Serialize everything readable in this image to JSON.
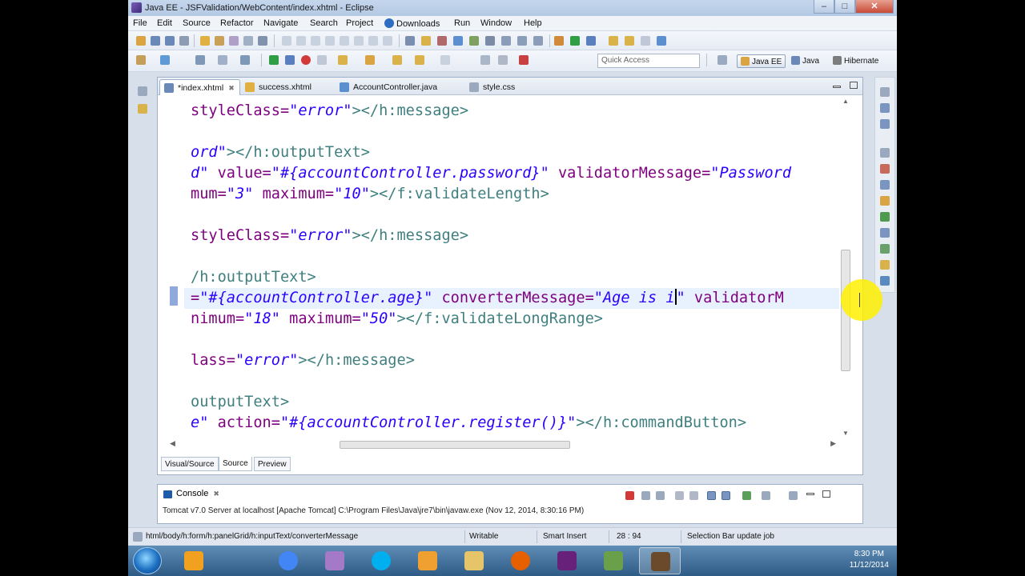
{
  "window": {
    "title": "Java EE - JSFValidation/WebContent/index.xhtml - Eclipse"
  },
  "menu": [
    "File",
    "Edit",
    "Source",
    "Refactor",
    "Navigate",
    "Search",
    "Project",
    "Downloads",
    "Run",
    "Window",
    "Help"
  ],
  "toolbar": {
    "quick_access_placeholder": "Quick Access"
  },
  "perspectives": [
    {
      "label": "Java EE",
      "active": true
    },
    {
      "label": "Java",
      "active": false
    },
    {
      "label": "Hibernate",
      "active": false
    }
  ],
  "editor": {
    "tabs": [
      {
        "label": "*index.xhtml",
        "active": true
      },
      {
        "label": "success.xhtml",
        "active": false
      },
      {
        "label": "AccountController.java",
        "active": false
      },
      {
        "label": "style.css",
        "active": false
      }
    ],
    "code": {
      "l1": {
        "a": "styleClass=",
        "b": "\"error\"",
        "c": "></h:message>"
      },
      "l2": {
        "a": "ord\"",
        "b": "></h:outputText>"
      },
      "l3": {
        "a": "d\"",
        "b": " value=",
        "c": "\"#{accountController.password}\"",
        "d": " validatorMessage=",
        "e": "\"Password"
      },
      "l4": {
        "a": "mum=",
        "b": "\"3\"",
        "c": " maximum=",
        "d": "\"10\"",
        "e": "></f:validateLength>"
      },
      "l5": {
        "a": "styleClass=",
        "b": "\"error\"",
        "c": "></h:message>"
      },
      "l6": {
        "a": "/h:outputText>"
      },
      "l7": {
        "a": "=",
        "b": "\"#{accountController.age}\"",
        "c": " converterMessage=",
        "d": "\"Age is i",
        "e": "\"",
        "f": " validatorM"
      },
      "l8": {
        "a": "nimum=",
        "b": "\"18\"",
        "c": " maximum=",
        "d": "\"50\"",
        "e": "></f:validateLongRange>"
      },
      "l9": {
        "a": "lass=",
        "b": "\"error\"",
        "c": "></h:message>"
      },
      "l10": {
        "a": "outputText>"
      },
      "l11": {
        "a": "e\"",
        "b": " action=",
        "c": "\"#{accountController.register()}\"",
        "d": "></h:commandButton>"
      }
    },
    "mode_tabs": [
      {
        "label": "Visual/Source",
        "active": false
      },
      {
        "label": "Source",
        "active": true
      },
      {
        "label": "Preview",
        "active": false
      }
    ]
  },
  "console": {
    "title": "Console",
    "text": "Tomcat v7.0 Server at localhost [Apache Tomcat] C:\\Program Files\\Java\\jre7\\bin\\javaw.exe (Nov 12, 2014, 8:30:16 PM)"
  },
  "status": {
    "path": "html/body/h:form/h:panelGrid/h:inputText/converterMessage",
    "writable": "Writable",
    "insert_mode": "Smart Insert",
    "position": "28 : 94",
    "job": "Selection Bar update job"
  },
  "taskbar": {
    "time": "8:30 PM",
    "date": "11/12/2014",
    "colors": {
      "start": "#1b6fc2",
      "chrome": "#4285f4",
      "skype": "#00aff0",
      "firefox": "#e66000",
      "visual_studio": "#68217a"
    }
  }
}
